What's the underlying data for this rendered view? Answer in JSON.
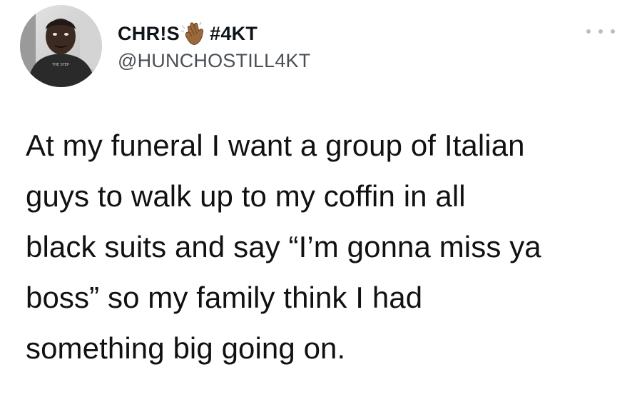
{
  "author": {
    "display_name": "CHR!S",
    "display_name_suffix": "#4KT",
    "name_emoji": "waving-hand-icon",
    "handle": "@HUNCHOSTILL4KT",
    "avatar_caption": "THE STEP"
  },
  "menu_icon": "more-dots-icon",
  "tweet": {
    "lines": [
      "At my funeral I want a group of Italian",
      "guys to walk up to my coffin in all",
      "black suits and say “I’m gonna miss ya",
      "boss” so my family think I had",
      "something big going on."
    ]
  },
  "colors": {
    "background": "#ffffff",
    "text": "#0f1419",
    "handle": "#4a4f55",
    "menu_dots": "#b9bdc1"
  }
}
